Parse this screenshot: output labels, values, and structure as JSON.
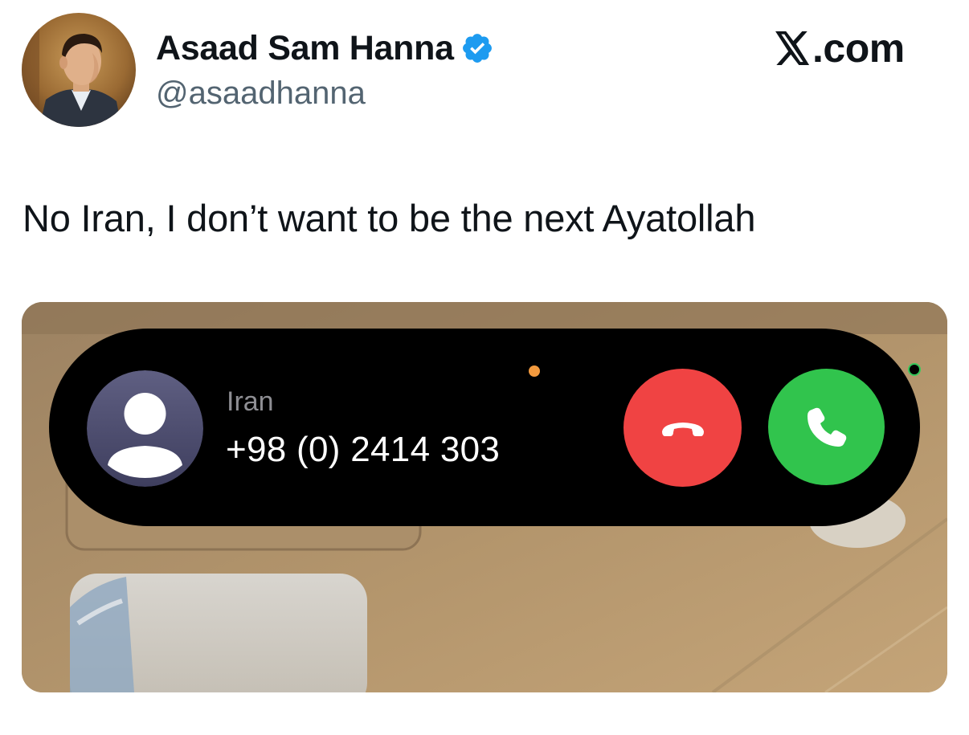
{
  "author": {
    "display_name": "Asaad Sam Hanna",
    "handle": "@asaadhanna",
    "verified": true,
    "avatar_icon": "profile-photo"
  },
  "brand": {
    "logo_icon": "x-logo-icon",
    "text": ".com"
  },
  "tweet": {
    "text": "No Iran, I don’t want to be the next Ayatollah"
  },
  "media": {
    "incoming_call": {
      "caller_name": "Iran",
      "caller_number": "+98 (0) 2414 303",
      "caller_avatar_icon": "person-silhouette-icon",
      "decline_icon": "phone-hangup-icon",
      "accept_icon": "phone-icon"
    }
  },
  "colors": {
    "text_primary": "#0f1419",
    "text_secondary": "#536471",
    "verified_blue": "#1d9bf0",
    "decline_red": "#f04343",
    "accept_green": "#31c44d",
    "mic_indicator": "#f39a3e",
    "camera_indicator": "#34c759"
  }
}
